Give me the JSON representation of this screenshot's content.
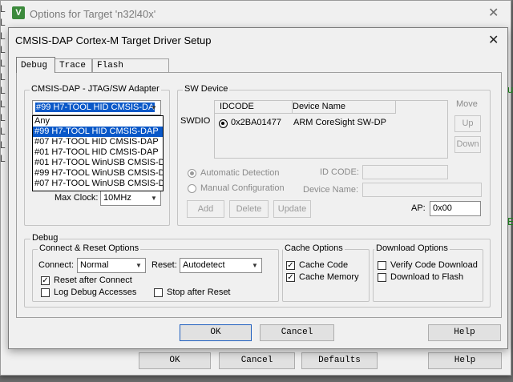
{
  "outer": {
    "title": "Options for Target 'n32l40x'",
    "icon": "V",
    "buttons": {
      "ok": "OK",
      "cancel": "Cancel",
      "defaults": "Defaults",
      "help": "Help"
    }
  },
  "dialog": {
    "title": "CMSIS-DAP Cortex-M Target Driver Setup",
    "tabs": [
      {
        "label": "Debug"
      },
      {
        "label": "Trace"
      },
      {
        "label": "Flash Download"
      }
    ],
    "adapter": {
      "group_label": "CMSIS-DAP - JTAG/SW Adapter",
      "selected": "#99 H7-TOOL HID CMSIS-DA",
      "options": [
        "Any",
        "#99 H7-TOOL HID CMSIS-DAP",
        "#07 H7-TOOL HID CMSIS-DAP",
        "#01 H7-TOOL HID CMSIS-DAP",
        "#01 H7-TOOL WinUSB CMSIS-D",
        "#99 H7-TOOL WinUSB CMSIS-D",
        "#07 H7-TOOL WinUSB CMSIS-D"
      ],
      "selected_index": 1,
      "max_clock_label": "Max Clock:",
      "max_clock_value": "10MHz"
    },
    "sw_device": {
      "group_label": "SW Device",
      "row_label": "SWDIO",
      "col_idcode": "IDCODE",
      "col_device_name": "Device Name",
      "rows": [
        {
          "idcode": "0x2BA01477",
          "device_name": "ARM CoreSight SW-DP"
        }
      ],
      "move_label": "Move",
      "up": "Up",
      "down": "Down",
      "auto_detection": "Automatic Detection",
      "manual_config": "Manual Configuration",
      "id_code_label": "ID CODE:",
      "device_name_label": "Device Name:",
      "add": "Add",
      "delete": "Delete",
      "update": "Update",
      "ap_label": "AP:",
      "ap_value": "0x00"
    },
    "debug": {
      "group_label": "Debug",
      "connect_reset": {
        "group_label": "Connect & Reset Options",
        "connect_label": "Connect:",
        "connect_value": "Normal",
        "reset_label": "Reset:",
        "reset_value": "Autodetect",
        "reset_after_connect": {
          "label": "Reset after Connect",
          "checked": true
        },
        "log_debug_accesses": {
          "label": "Log Debug Accesses",
          "checked": false
        },
        "stop_after_reset": {
          "label": "Stop after Reset",
          "checked": false
        }
      },
      "cache": {
        "group_label": "Cache Options",
        "cache_code": {
          "label": "Cache Code",
          "checked": true
        },
        "cache_memory": {
          "label": "Cache Memory",
          "checked": true
        }
      },
      "download": {
        "group_label": "Download Options",
        "verify": {
          "label": "Verify Code Download",
          "checked": false
        },
        "download_to_flash": {
          "label": "Download to Flash",
          "checked": false
        }
      }
    },
    "buttons": {
      "ok": "OK",
      "cancel": "Cancel",
      "help": "Help"
    }
  },
  "background_edge": {
    "left_char": "L",
    "right_chars": [
      "u",
      "E"
    ]
  },
  "colors": {
    "selection": "#0a58c8",
    "dialog_bg": "#f0f0f0"
  },
  "icons": [
    "close-icon",
    "radio-selected-icon",
    "check-icon",
    "dropdown-arrow-icon"
  ]
}
